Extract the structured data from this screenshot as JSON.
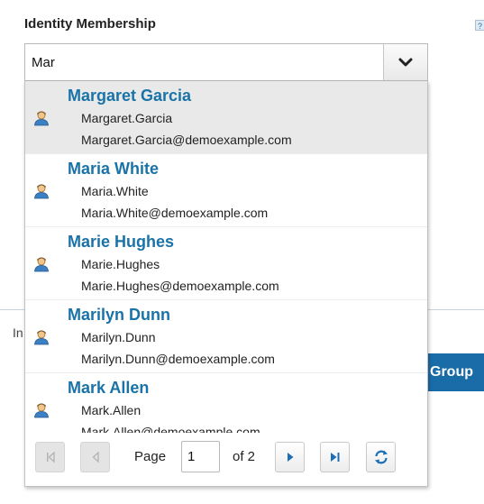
{
  "form": {
    "title": "Identity Membership",
    "help_icon": "?",
    "search_value": "Mar"
  },
  "icons": {
    "dropdown": "chevron-down-icon",
    "user": "user-icon",
    "first": "first-page-icon",
    "prev": "previous-page-icon",
    "next": "next-page-icon",
    "last": "last-page-icon",
    "refresh": "refresh-icon"
  },
  "results": [
    {
      "name": "Margaret Garcia",
      "username": "Margaret.Garcia",
      "email": "Margaret.Garcia@demoexample.com",
      "selected": true
    },
    {
      "name": "Maria White",
      "username": "Maria.White",
      "email": "Maria.White@demoexample.com",
      "selected": false
    },
    {
      "name": "Marie Hughes",
      "username": "Marie.Hughes",
      "email": "Marie.Hughes@demoexample.com",
      "selected": false
    },
    {
      "name": "Marilyn Dunn",
      "username": "Marilyn.Dunn",
      "email": "Marilyn.Dunn@demoexample.com",
      "selected": false
    },
    {
      "name": "Mark Allen",
      "username": "Mark.Allen",
      "email": "Mark.Allen@demoexample.com",
      "selected": false
    }
  ],
  "pager": {
    "page_label": "Page",
    "current_page": "1",
    "of_label": "of 2"
  },
  "background": {
    "partial_label": "In",
    "partial_button": "Group"
  },
  "colors": {
    "name_link": "#1a73a8",
    "accent_button": "#1a6ca8",
    "selected_row": "#e9e9e9",
    "pager_arrow": "#1c6fb4"
  }
}
